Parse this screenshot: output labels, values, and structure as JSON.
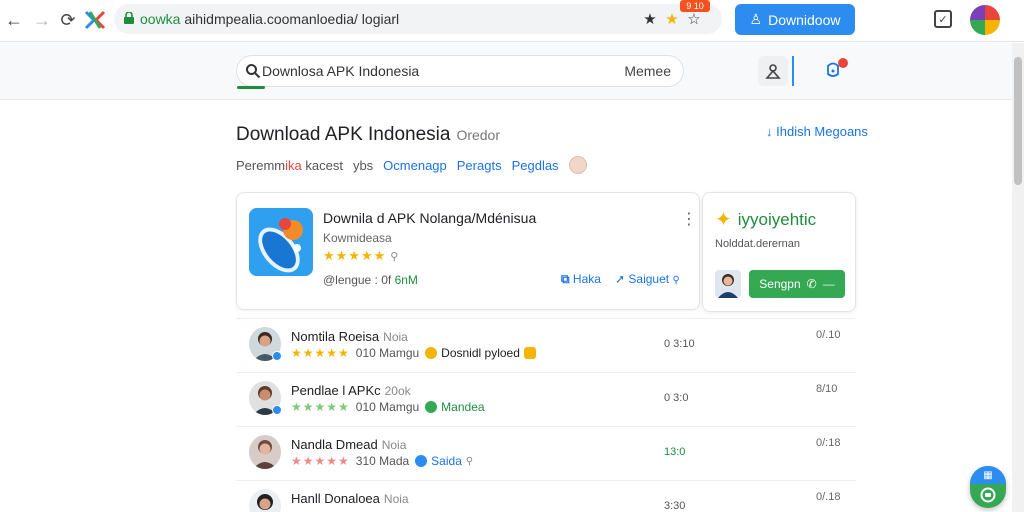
{
  "browser": {
    "back_icon": "arrow-left-icon",
    "forward_icon": "arrow-right-icon",
    "reload_icon": "reload-icon",
    "url_prefix": "oowka",
    "url_rest": " aihidmpealia.coomanloedia/ logiarl",
    "notif_badge": "9 10",
    "download_button_label": "Downidoow"
  },
  "appbar": {
    "search_value": "Downlosa APK Indonesia",
    "search_right": "Memee"
  },
  "page": {
    "title": "Download APK Indonesia",
    "title_sub": "Oredor",
    "title_link": "Ihdish Megoans",
    "filters": {
      "label_pre": "Peremm",
      "label_red": "ika",
      "label_post": " kacest",
      "item1": "ybs",
      "chip1": "Ocmenagp",
      "chip2": "Peragts",
      "chip3": "Pegdlas"
    }
  },
  "app_card": {
    "name": "Downila d APK Nolanga/Mdénisua",
    "developer": "Kowmideasa",
    "stars": "★★★★★",
    "meta_pre": "@lengue : 0f ",
    "meta_green": "6nM",
    "action1": "Haka",
    "action2": "Saiguet"
  },
  "promo": {
    "title": "iyyoiyehtic",
    "subtitle": "Nolddat.derernan",
    "button_label": "Sengpn"
  },
  "reviews": [
    {
      "name": "Nomtila Roeisa",
      "name_muted": "Noia",
      "stars": "★★★★★",
      "stars_color": "#f4b400",
      "meta": "010 Mamgu",
      "tag": "Dosnidl pyloed",
      "tag_color": "#202124",
      "score": "0 3:10",
      "time": "0/.10"
    },
    {
      "name": "Pendlae l APKc",
      "name_muted": "20ok",
      "stars": "★★★★★",
      "stars_color": "#7ec87a",
      "meta": "010 Mamgu",
      "tag": "Mandea",
      "tag_color": "#1e8e3e",
      "score": "0 3:0",
      "time": "8/10"
    },
    {
      "name": "Nandla Dmead",
      "name_muted": "Noia",
      "stars": "★★★★★",
      "stars_color": "#f08a8a",
      "meta": "310 Mada",
      "tag": "Saida",
      "tag_color": "#1a73e8",
      "score": "13:0",
      "time": "0/:18"
    },
    {
      "name": "Hanll Donaloea",
      "name_muted": "Noia",
      "stars": "",
      "stars_color": "#f4b400",
      "meta": "",
      "tag": "",
      "tag_color": "#202124",
      "score": "3:30",
      "time": "0/.18"
    }
  ],
  "colors": {
    "accent_blue": "#2d8cf0",
    "accent_green": "#34a853",
    "star_gold": "#f4b400"
  }
}
